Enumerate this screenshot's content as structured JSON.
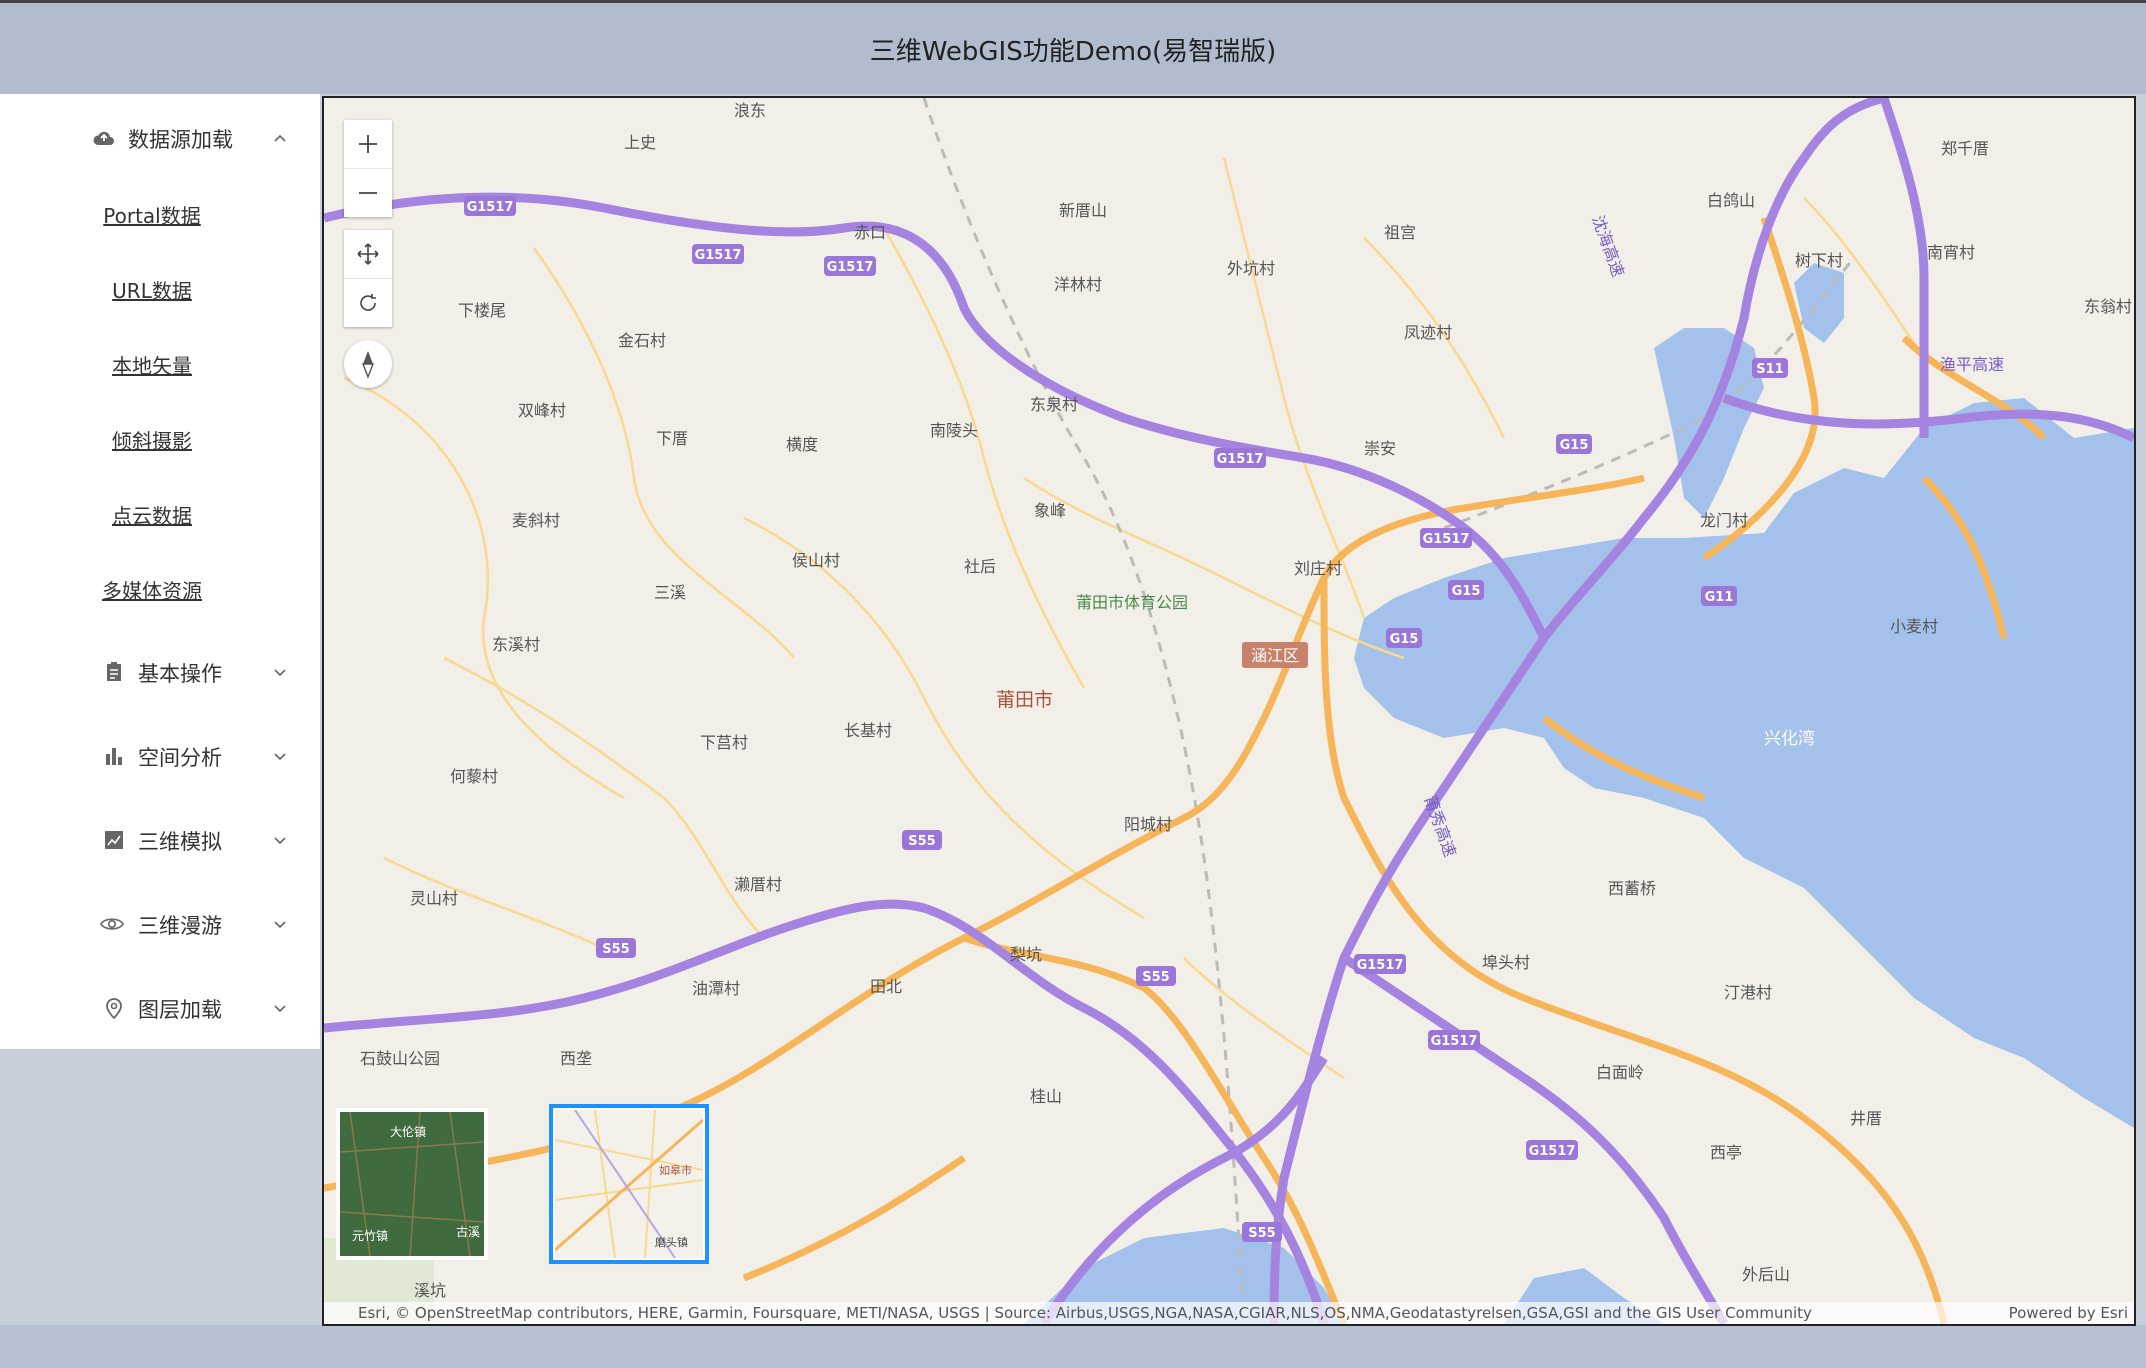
{
  "header": {
    "title": "三维WebGIS功能Demo(易智瑞版)"
  },
  "sidebar": {
    "data_source": {
      "label": "数据源加载",
      "icon": "cloud-icon",
      "items": [
        "Portal数据",
        "URL数据",
        "本地矢量",
        "倾斜摄影",
        "点云数据",
        "多媒体资源"
      ]
    },
    "groups": [
      {
        "label": "基本操作",
        "icon": "clipboard-icon"
      },
      {
        "label": "空间分析",
        "icon": "bar-chart-icon"
      },
      {
        "label": "三维模拟",
        "icon": "line-chart-icon"
      },
      {
        "label": "三维漫游",
        "icon": "eye-icon"
      },
      {
        "label": "图层加载",
        "icon": "location-pin-icon"
      }
    ]
  },
  "map": {
    "labels": {
      "shangshi": "上史",
      "langdong": "浪东",
      "xinmeishan": "新厝山",
      "zugong": "祖宫",
      "baishan": "白鸽山",
      "zhengqian": "郑千厝",
      "shuxiacun": "树下村",
      "nanxiao": "南宵村",
      "dongcang": "东翁村",
      "chikou": "赤口",
      "xialouwei": "下楼尾",
      "jinshicun": "金石村",
      "yanglincun": "洋林村",
      "waikengcun": "外坑村",
      "fengjicun": "凤迹村",
      "shuangfengcun": "双峰村",
      "xiacuo": "下厝",
      "hengdu": "横度",
      "nanlingtou": "南陵头",
      "dongquancun": "东泉村",
      "chongan": "崇安",
      "maxiecun": "麦斜村",
      "xiangfeng": "象峰",
      "longmencun": "龙门村",
      "sanxi": "三溪",
      "houshancun": "侯山村",
      "shehou": "社后",
      "liuzhuangcun": "刘庄村",
      "stadium": "莆田市体育公园",
      "district": "涵江区",
      "dongxicun": "东溪村",
      "xiaomaicun": "小麦村",
      "city": "莆田市",
      "xialvcun": "下莒村",
      "changjicun": "长基村",
      "xinghuawan": "兴化湾",
      "hebeicun": "何藜村",
      "yangchengcun": "阳城村",
      "lingshancun": "灵山村",
      "laixi": "濑厝村",
      "xicuoqiao": "西蓄桥",
      "likeng": "梨坑",
      "bitoucun": "埠头村",
      "youtancun": "油潭村",
      "tianbei": "田北",
      "tinggangcun": "汀港村",
      "shigushan": "石鼓山公园",
      "xiying": "西垄",
      "baimian": "白面岭",
      "guishan": "桂山",
      "jinghao": "井厝",
      "xiting": "西亭",
      "waihoushan": "外后山",
      "xikeng": "溪坑",
      "shenhai": "沈海高速",
      "yuping": "渔平高速",
      "puxiu": "莆秀高速"
    },
    "shields": [
      "G1517",
      "G1517",
      "G1517",
      "G1517",
      "G1517",
      "G15",
      "G15",
      "G15",
      "G11",
      "S11",
      "S55",
      "S55",
      "S55",
      "S55",
      "G1517",
      "G1517",
      "G1517"
    ],
    "basemap_thumbs": {
      "imagery": {
        "label1": "大伦镇",
        "label2": "元竹镇",
        "label3": "古溪"
      },
      "street": {
        "label1": "如皋市",
        "label2": "磨头镇"
      }
    },
    "attribution": "Esri, © OpenStreetMap contributors, HERE, Garmin, Foursquare, METI/NASA, USGS | Source: Airbus,USGS,NGA,NASA,CGIAR,NLS,OS,NMA,Geodatastyrelsen,GSA,GSI and the GIS User Community",
    "powered_by": "Powered by Esri",
    "colors": {
      "water": "#a3c1ea",
      "land": "#f2efe9",
      "highway": "#a583e0",
      "major_road": "#f6b559",
      "minor_road": "#f8d98f",
      "selection": "#1e90ff"
    }
  }
}
